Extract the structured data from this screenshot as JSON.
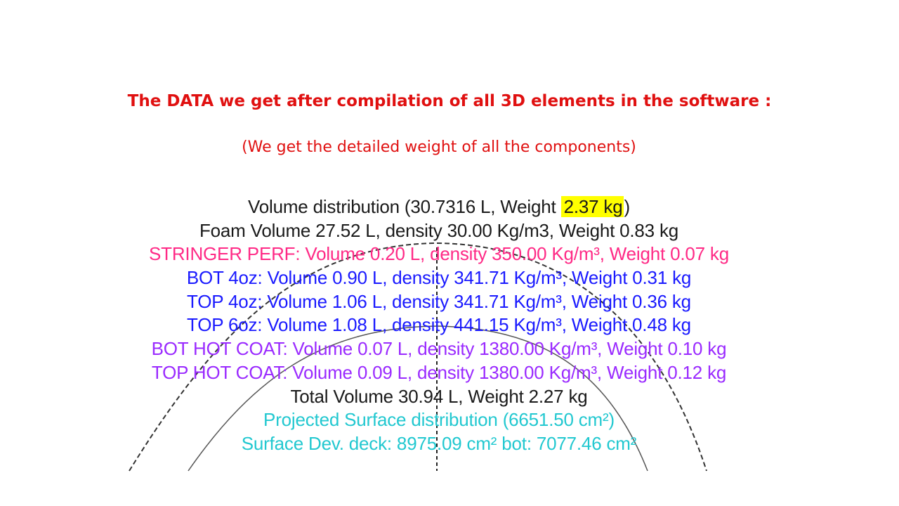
{
  "heading": {
    "title": "The DATA we get after compilation of all 3D elements in the software :",
    "subtitle": "(We get the detailed weight of all the components)"
  },
  "software_output": {
    "volume_distribution_prefix": "Volume distribution (30.7316 L, Weight ",
    "volume_distribution_weight": "2.37 kg",
    "volume_distribution_suffix": ")",
    "foam": "Foam Volume 27.52 L, density 30.00 Kg/m3, Weight  0.83 kg",
    "stringer": "STRINGER PERF: Volume 0.20 L, density 350.00 Kg/m³, Weight  0.07 kg",
    "bot_4oz": "BOT 4oz: Volume 0.90 L, density 341.71 Kg/m³, Weight  0.31 kg",
    "top_4oz": "TOP 4oz: Volume 1.06 L, density 341.71 Kg/m³, Weight  0.36 kg",
    "top_6oz": "TOP 6oz: Volume 1.08 L, density 441.15 Kg/m³, Weight  0.48 kg",
    "bot_hot_coat": "BOT HOT COAT: Volume 0.07 L, density 1380.00 Kg/m³, Weight  0.10 kg",
    "top_hot_coat": "TOP HOT COAT: Volume 0.09 L, density 1380.00 Kg/m³, Weight  0.12 kg",
    "total": "Total Volume 30.94 L, Weight  2.27 kg",
    "projected_surface": "Projected Surface distribution (6651.50 cm²)",
    "surface_dev": "Surface Dev. deck: 8975.09 cm² bot: 7077.46 cm²"
  },
  "colors": {
    "heading": "#e01010",
    "black": "#1a1a1a",
    "pink": "#ff2a86",
    "blue": "#1a1aff",
    "purple": "#9a2aff",
    "cyan": "#22c8d0",
    "highlight": "#ffff00"
  }
}
